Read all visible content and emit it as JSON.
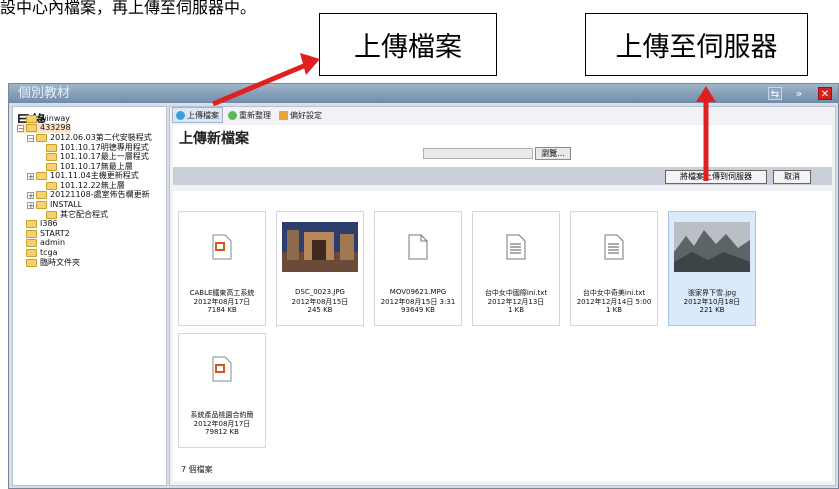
{
  "caption": "設中心內檔案，再上傳至伺服器中。",
  "callouts": {
    "upload": "上傳檔案",
    "server": "上傳至伺服器"
  },
  "window": {
    "title": "個別教材"
  },
  "sidebar": {
    "title": "目錄",
    "tree": [
      {
        "label": "winway",
        "indent": 0,
        "expander": ""
      },
      {
        "label": "433298",
        "indent": 0,
        "expander": "−",
        "selected": true
      },
      {
        "label": "2012.06.03第二代安裝程式",
        "indent": 1,
        "expander": "−"
      },
      {
        "label": "101.10.17明德專用程式",
        "indent": 2,
        "expander": ""
      },
      {
        "label": "101.10.17最上一層程式",
        "indent": 2,
        "expander": ""
      },
      {
        "label": "101.10.17無最上層",
        "indent": 2,
        "expander": ""
      },
      {
        "label": "101.11.04主機更新程式",
        "indent": 1,
        "expander": "+"
      },
      {
        "label": "101.12.22無上層",
        "indent": 2,
        "expander": ""
      },
      {
        "label": "20121108-處室佈告欄更新",
        "indent": 1,
        "expander": "+"
      },
      {
        "label": "INSTALL",
        "indent": 1,
        "expander": "+"
      },
      {
        "label": "其它配合程式",
        "indent": 2,
        "expander": ""
      },
      {
        "label": "I386",
        "indent": 0,
        "expander": ""
      },
      {
        "label": "START2",
        "indent": 0,
        "expander": ""
      },
      {
        "label": "admin",
        "indent": 0,
        "expander": ""
      },
      {
        "label": "tcga",
        "indent": 0,
        "expander": ""
      },
      {
        "label": "臨時文件夾",
        "indent": 0,
        "expander": ""
      }
    ]
  },
  "toolbar": {
    "upload": "上傳檔案",
    "refresh": "重新整理",
    "settings": "偏好設定"
  },
  "upload": {
    "title": "上傳新檔案",
    "browse": "瀏覽...",
    "to_server": "將檔案上傳到伺服器",
    "cancel": "取消"
  },
  "files": [
    {
      "name": "CABLE鐵東高工系統",
      "date": "2012年08月17日",
      "size": "7184 KB",
      "icon": "ppt-icon"
    },
    {
      "name": "DSC_0023.JPG",
      "date": "2012年08月15日",
      "size": "245 KB",
      "icon": "photo-thumbnail"
    },
    {
      "name": "MOV09621.MPG",
      "date": "2012年08月15日 3:31",
      "size": "93649 KB",
      "icon": "generic-file-icon"
    },
    {
      "name": "台中女中國際ini.txt",
      "date": "2012年12月13日",
      "size": "1 KB",
      "icon": "text-file-icon"
    },
    {
      "name": "台中女中奇美ini.txt",
      "date": "2012年12月14日 5:00",
      "size": "1 KB",
      "icon": "text-file-icon"
    },
    {
      "name": "張家界下雪.jpg",
      "date": "2012年10月18日",
      "size": "221 KB",
      "icon": "photo-thumbnail",
      "selected": true
    },
    {
      "name": "系統產品桃園合約簡",
      "date": "2012年08月17日",
      "size": "79812 KB",
      "icon": "ppt-icon"
    }
  ],
  "footer": {
    "count": "7 個檔案"
  },
  "colors": {
    "arrow": "#e02020",
    "titlebar": "#7f9ab5"
  }
}
